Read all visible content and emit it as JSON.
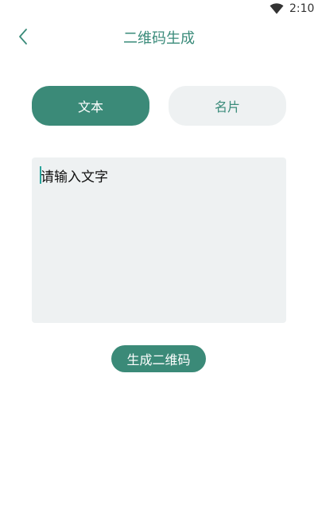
{
  "status_bar": {
    "time": "2:10",
    "icons": [
      "wifi-icon"
    ]
  },
  "app_bar": {
    "title": "二维码生成",
    "back_icon": "chevron-left-icon"
  },
  "tabs": [
    {
      "label": "文本",
      "selected": true
    },
    {
      "label": "名片",
      "selected": false
    }
  ],
  "text_input": {
    "placeholder": "请输入文字",
    "value": ""
  },
  "generate_button": {
    "label": "生成二维码"
  },
  "colors": {
    "accent": "#3b8a78",
    "title": "#3a8b7a",
    "inactive_tab_bg": "#eef1f2",
    "input_bg": "#eef1f2",
    "caret": "#2aa39b"
  }
}
